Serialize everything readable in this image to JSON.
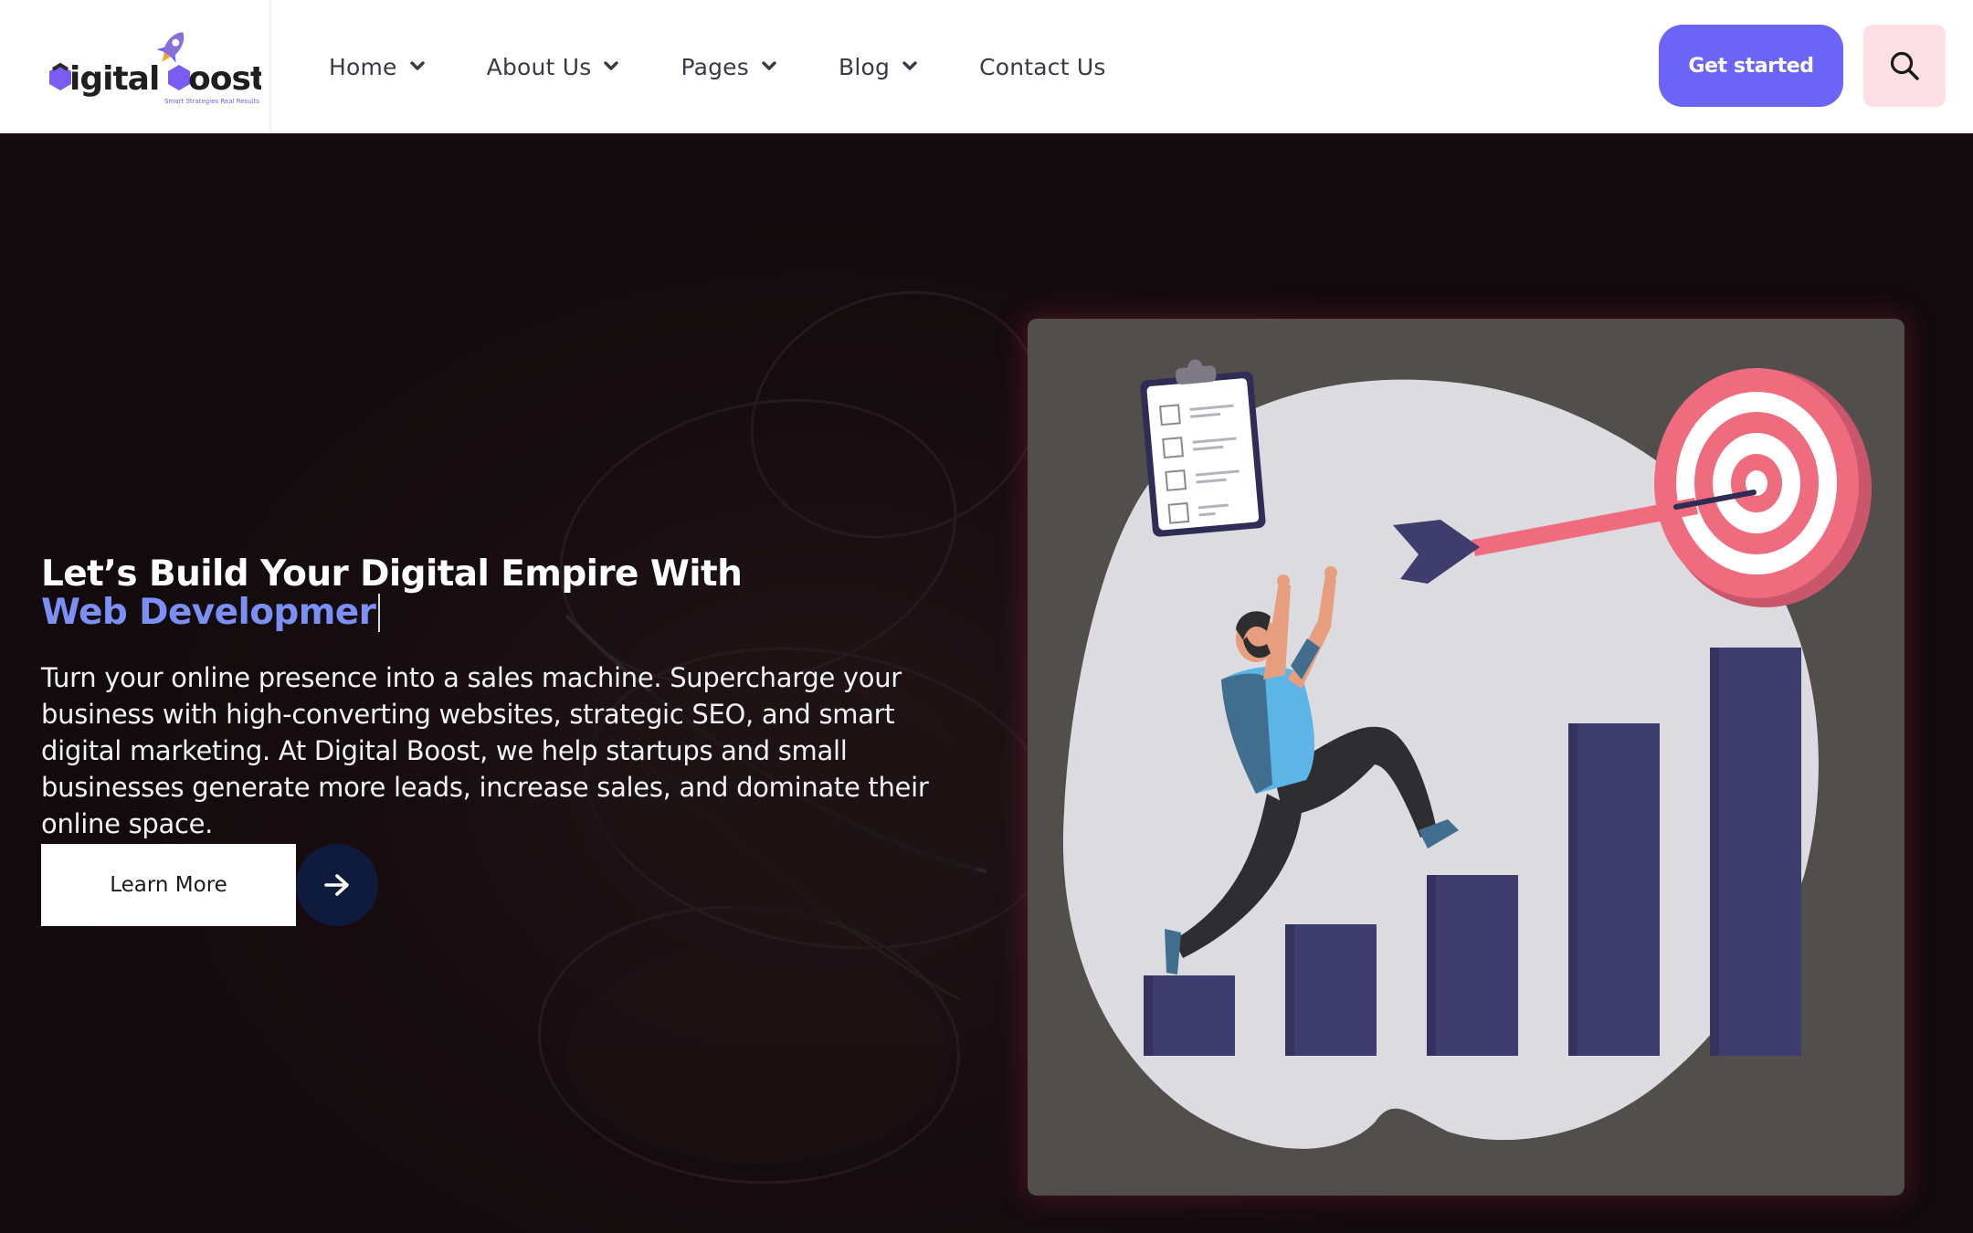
{
  "brand": {
    "logo_text": "Digital Boost",
    "tagline": "Smart Strategies Real Results"
  },
  "nav": {
    "items": [
      {
        "label": "Home",
        "has_dropdown": true
      },
      {
        "label": "About Us",
        "has_dropdown": true
      },
      {
        "label": "Pages",
        "has_dropdown": true
      },
      {
        "label": "Blog",
        "has_dropdown": true
      },
      {
        "label": "Contact Us",
        "has_dropdown": false
      }
    ],
    "cta_label": "Get started",
    "search_icon": "search-icon"
  },
  "hero": {
    "headline": "Let’s Build Your Digital Empire With",
    "headline_accent": "Web Developmer",
    "description": "Turn your online presence into a sales machine. Supercharge your business with high-converting websites, strategic SEO, and smart digital marketing. At Digital Boost, we help startups and small businesses generate more leads, increase sales, and dominate their online space.",
    "learn_more_label": "Learn More",
    "arrow_icon": "arrow-right-icon"
  },
  "colors": {
    "primary": "#6c63f7",
    "accent_text": "#7b8ff5",
    "search_bg": "#fde0e5",
    "hero_bg": "#150b0e",
    "arrow_button": "#0f1b3d",
    "bar_color": "#3f3c6e",
    "target_red": "#ef6b7e"
  }
}
